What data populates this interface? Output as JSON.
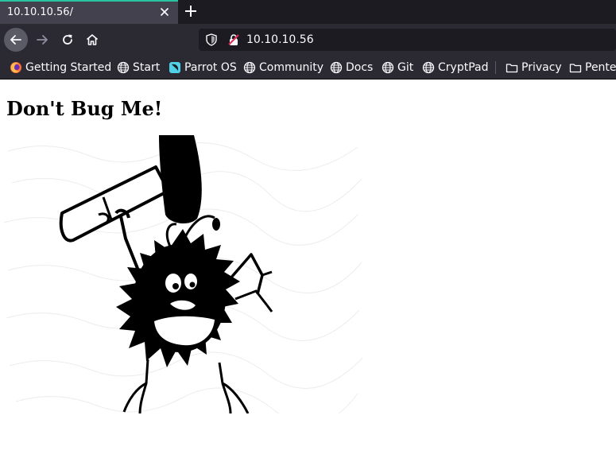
{
  "browser": {
    "tab": {
      "title": "10.10.10.56/"
    },
    "url": "10.10.10.56",
    "accent_color": "#2ac3a2",
    "bookmarks": [
      {
        "label": "Getting Started",
        "icon": "firefox-icon"
      },
      {
        "label": "Start",
        "icon": "globe-icon"
      },
      {
        "label": "Parrot OS",
        "icon": "parrot-icon"
      },
      {
        "label": "Community",
        "icon": "globe-icon"
      },
      {
        "label": "Docs",
        "icon": "globe-icon"
      },
      {
        "label": "Git",
        "icon": "globe-icon"
      },
      {
        "label": "CryptPad",
        "icon": "globe-icon"
      },
      {
        "label": "Privacy",
        "icon": "folder-icon"
      },
      {
        "label": "Pente",
        "icon": "folder-icon"
      }
    ]
  },
  "page": {
    "heading": "Don't Bug Me!",
    "image": "cartoon-bug-with-hammer"
  }
}
